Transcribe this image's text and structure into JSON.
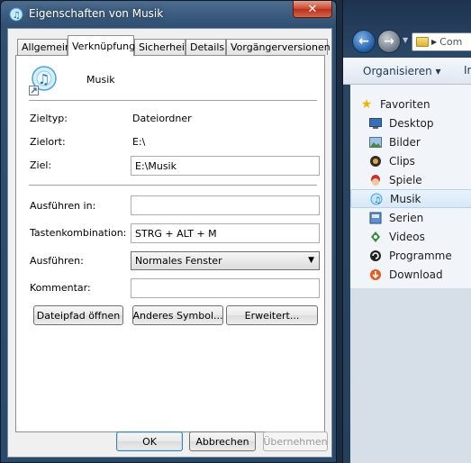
{
  "dialog": {
    "title": "Eigenschaften von Musik",
    "close_glyph": "✕",
    "tabs": [
      {
        "label": "Allgemein"
      },
      {
        "label": "Verknüpfung"
      },
      {
        "label": "Sicherheit"
      },
      {
        "label": "Details"
      },
      {
        "label": "Vorgängerversionen"
      }
    ],
    "active_tab": "Verknüpfung",
    "name": "Musik",
    "fields": {
      "target_type_label": "Zieltyp:",
      "target_type_value": "Dateiordner",
      "target_location_label": "Zielort:",
      "target_location_value": "E:\\",
      "target_label": "Ziel:",
      "target_value": "E:\\Musik",
      "start_in_label": "Ausführen in:",
      "start_in_value": "",
      "shortcut_key_label": "Tastenkombination:",
      "shortcut_key_value": "STRG + ALT + M",
      "run_label": "Ausführen:",
      "run_value": "Normales Fenster",
      "comment_label": "Kommentar:",
      "comment_value": ""
    },
    "action_buttons": {
      "open_location": "Dateipfad öffnen",
      "change_icon": "Anderes Symbol...",
      "advanced": "Erweitert..."
    },
    "footer_buttons": {
      "ok": "OK",
      "cancel": "Abbrechen",
      "apply": "Übernehmen"
    }
  },
  "explorer": {
    "address_text": "Com",
    "organize_label": "Organisieren ▾",
    "next_cmd_label": "In",
    "favorites_label": "Favoriten",
    "nav_items": [
      {
        "label": "Desktop",
        "icon": "desktop-icon"
      },
      {
        "label": "Bilder",
        "icon": "pictures-icon"
      },
      {
        "label": "Clips",
        "icon": "clips-icon"
      },
      {
        "label": "Spiele",
        "icon": "games-icon"
      },
      {
        "label": "Musik",
        "icon": "music-icon",
        "selected": true
      },
      {
        "label": "Serien",
        "icon": "series-icon"
      },
      {
        "label": "Videos",
        "icon": "videos-icon"
      },
      {
        "label": "Programme",
        "icon": "programs-icon"
      },
      {
        "label": "Download",
        "icon": "download-icon"
      }
    ]
  }
}
